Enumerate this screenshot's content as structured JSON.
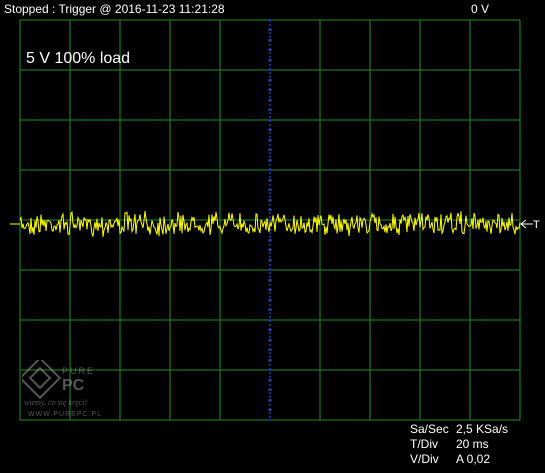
{
  "status": {
    "left": "Stopped : Trigger @ 2016-11-23 11:21:28",
    "right": "0  V"
  },
  "caption": "5 V 100% load",
  "trigger_label": "T",
  "readouts": [
    {
      "label": "Sa/Sec",
      "value": "2,5 KSa/s"
    },
    {
      "label": "T/Div",
      "value": "20 ms"
    },
    {
      "label": "V/Div",
      "value": "A 0,02"
    }
  ],
  "watermark": {
    "brand": "PUREPC",
    "tagline": "wiemy, co się kręci!",
    "url": "WWW.PUREPC.PL"
  },
  "colors": {
    "grid": "#1f8f1f",
    "trace": "#ffff00",
    "center_axis": "#2b5bff",
    "background": "#000000",
    "text": "#ffffff"
  },
  "scope": {
    "trace_level": "0 V",
    "noise_amplitude_divisions": 0.3
  }
}
